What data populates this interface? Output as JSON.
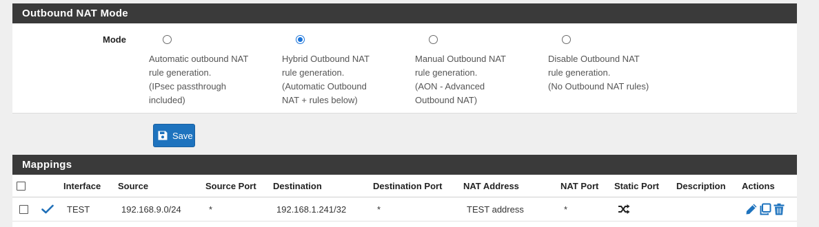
{
  "nat_mode": {
    "title": "Outbound NAT Mode",
    "mode_label": "Mode",
    "options": [
      {
        "lines": [
          "Automatic outbound NAT",
          "rule generation.",
          "(IPsec passthrough",
          "included)"
        ],
        "checked": false
      },
      {
        "lines": [
          "Hybrid Outbound NAT",
          "rule generation.",
          "(Automatic Outbound",
          "NAT + rules below)"
        ],
        "checked": true
      },
      {
        "lines": [
          "Manual Outbound NAT",
          "rule generation.",
          "(AON - Advanced",
          "Outbound NAT)"
        ],
        "checked": false
      },
      {
        "lines": [
          "Disable Outbound NAT",
          "rule generation.",
          "(No Outbound NAT rules)"
        ],
        "checked": false
      }
    ],
    "save_label": "Save"
  },
  "mappings": {
    "title": "Mappings",
    "headers": {
      "interface": "Interface",
      "source": "Source",
      "source_port": "Source Port",
      "destination": "Destination",
      "destination_port": "Destination Port",
      "nat_address": "NAT Address",
      "nat_port": "NAT Port",
      "static_port": "Static Port",
      "description": "Description",
      "actions": "Actions"
    },
    "rows": [
      {
        "enabled_icon": "check-icon",
        "interface": "TEST",
        "source": "192.168.9.0/24",
        "source_port": "*",
        "destination": "192.168.1.241/32",
        "destination_port": "*",
        "nat_address": "TEST address",
        "nat_port": "*",
        "static_port_icon": "random-icon",
        "description": "",
        "action_icons": [
          "pencil-icon",
          "copy-icon",
          "trash-icon"
        ]
      }
    ]
  },
  "colors": {
    "panel_header": "#3a3a3a",
    "accent_blue": "#1e73be",
    "radio_selected": "#1a73d9"
  }
}
